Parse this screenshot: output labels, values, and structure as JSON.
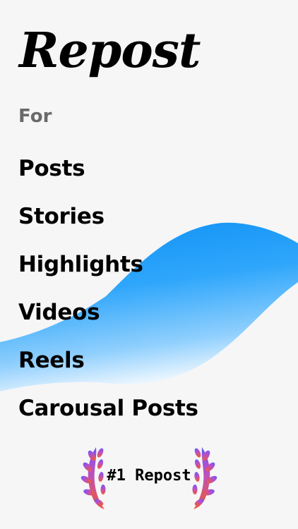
{
  "app": {
    "title": "Repost"
  },
  "subtitle": "For",
  "features": [
    "Posts",
    "Stories",
    "Highlights",
    "Videos",
    "Reels",
    "Carousal Posts"
  ],
  "badge": {
    "text": "#1 Repost"
  },
  "colors": {
    "accent_blue": "#1a9bf6",
    "text": "#000000",
    "muted": "#6a6a6a",
    "background": "#f6f6f7"
  },
  "icons": {
    "badge_left": "laurel-left-icon",
    "badge_right": "laurel-right-icon"
  }
}
